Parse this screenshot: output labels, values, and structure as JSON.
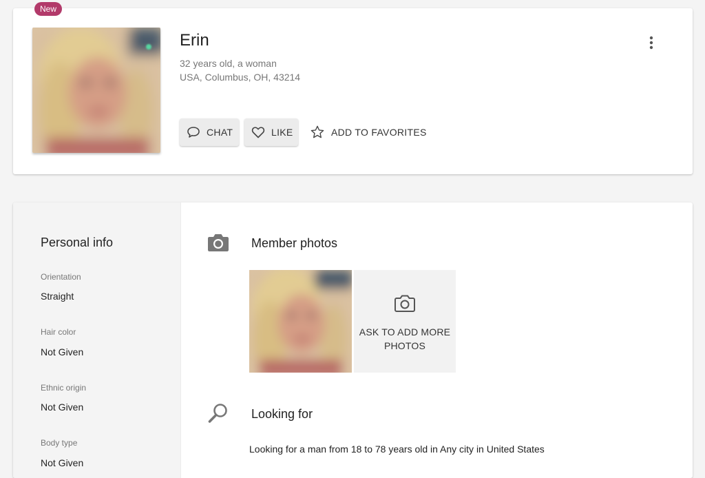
{
  "profile": {
    "badge": "New",
    "name": "Erin",
    "age_gender": "32 years old, a woman",
    "location": "USA, Columbus, OH, 43214",
    "online": true
  },
  "actions": {
    "chat_label": "CHAT",
    "like_label": "LIKE",
    "favorites_label": "ADD TO FAVORITES",
    "more_icon": "more-vertical-icon"
  },
  "personal_info": {
    "title": "Personal info",
    "fields": [
      {
        "label": "Orientation",
        "value": "Straight"
      },
      {
        "label": "Hair color",
        "value": "Not Given"
      },
      {
        "label": "Ethnic origin",
        "value": "Not Given"
      },
      {
        "label": "Body type",
        "value": "Not Given"
      }
    ]
  },
  "photos": {
    "title": "Member photos",
    "ask_more_label": "ASK TO ADD MORE PHOTOS",
    "icon": "camera-icon"
  },
  "looking_for": {
    "title": "Looking for",
    "text": "Looking for a man from 18 to 78 years old in Any city in United States",
    "icon": "search-icon"
  },
  "colors": {
    "badge": "#b23a6a",
    "online": "#57d6a1",
    "background": "#f4f4f4"
  }
}
